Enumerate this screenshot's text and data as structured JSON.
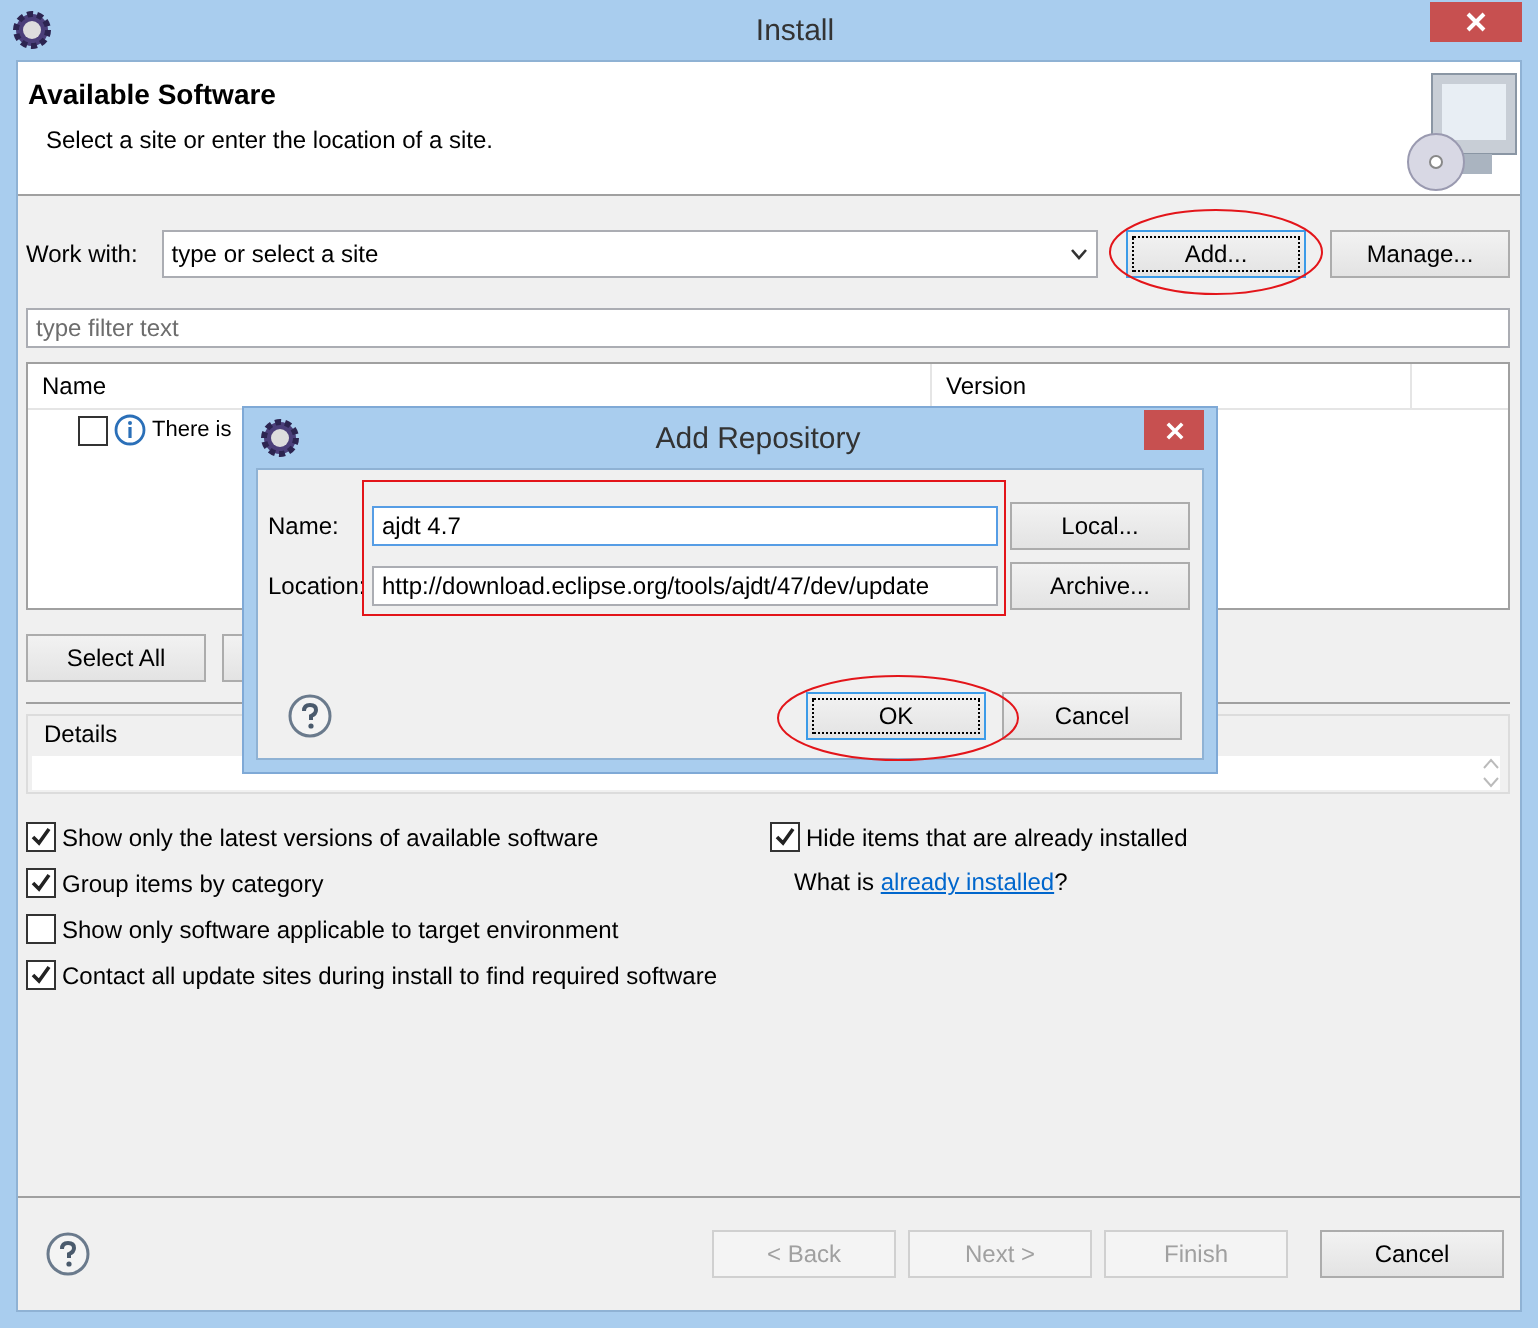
{
  "window": {
    "title": "Install"
  },
  "header": {
    "title": "Available Software",
    "subtitle": "Select a site or enter the location of a site."
  },
  "work_with": {
    "label": "Work with:",
    "value": "type or select a site",
    "buttons": [
      {
        "label": "Add...",
        "focused": true
      },
      {
        "label": "Manage...",
        "focused": false
      }
    ]
  },
  "filter": {
    "placeholder": "type filter text"
  },
  "table": {
    "columns": [
      "Name",
      "Version"
    ],
    "rows": [
      {
        "checked": false,
        "name": "There is"
      }
    ]
  },
  "list_buttons": [
    {
      "label": "Select All"
    }
  ],
  "details": {
    "label": "Details"
  },
  "options": [
    {
      "label": "Show only the latest versions of available software",
      "checked": true
    },
    {
      "label": "Group items by category",
      "checked": true
    },
    {
      "label": "Show only software applicable to target environment",
      "checked": false
    },
    {
      "label": "Contact all update sites during install to find required software",
      "checked": true
    }
  ],
  "hide_installed": {
    "label": "Hide items that are already installed",
    "checked": true
  },
  "installed_link": {
    "prefix": "What is",
    "link": "already installed",
    "suffix": "?"
  },
  "footer_buttons": [
    {
      "label": "< Back",
      "disabled": true
    },
    {
      "label": "Next >",
      "disabled": true
    },
    {
      "label": "Finish",
      "disabled": true
    },
    {
      "label": "Cancel",
      "disabled": false
    }
  ],
  "dialog": {
    "title": "Add Repository",
    "fields": [
      {
        "label": "Name:",
        "value": "ajdt 4.7",
        "focused": true,
        "button": {
          "label": "Local..."
        }
      },
      {
        "label": "Location:",
        "value": "http://download.eclipse.org/tools/ajdt/47/dev/update",
        "focused": false,
        "button": {
          "label": "Archive..."
        }
      }
    ],
    "buttons": [
      {
        "label": "OK",
        "focused": true
      },
      {
        "label": "Cancel",
        "focused": false
      }
    ]
  }
}
